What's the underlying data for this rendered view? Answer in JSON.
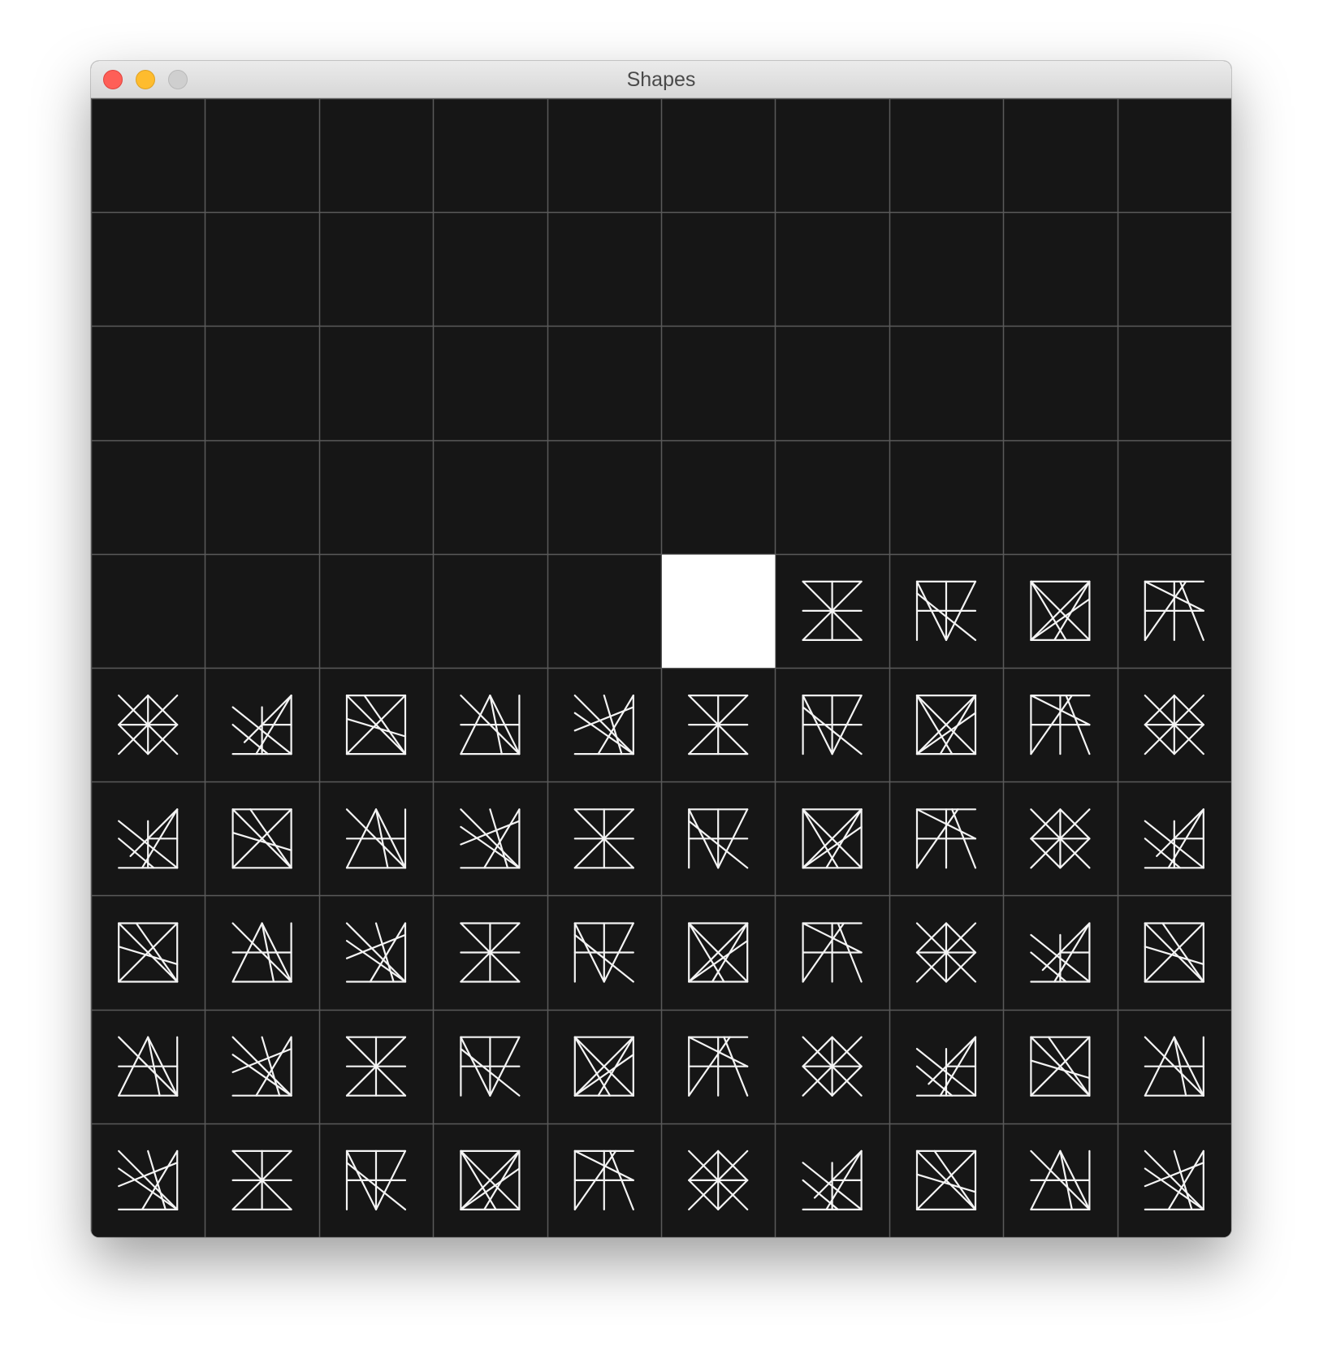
{
  "window": {
    "title": "Shapes"
  },
  "grid": {
    "columns": 10,
    "rows": 10,
    "background_color": "#161616",
    "gridline_color": "#5a5a5a",
    "stroke_color": "#f4f4f4",
    "selected_color": "#ffffff",
    "empty_cells": 45,
    "selected_cell_index": 45,
    "shape_cycle": [
      "shape-a",
      "shape-b",
      "shape-c",
      "shape-d",
      "shape-e",
      "shape-f",
      "shape-g",
      "shape-h",
      "shape-i"
    ]
  }
}
